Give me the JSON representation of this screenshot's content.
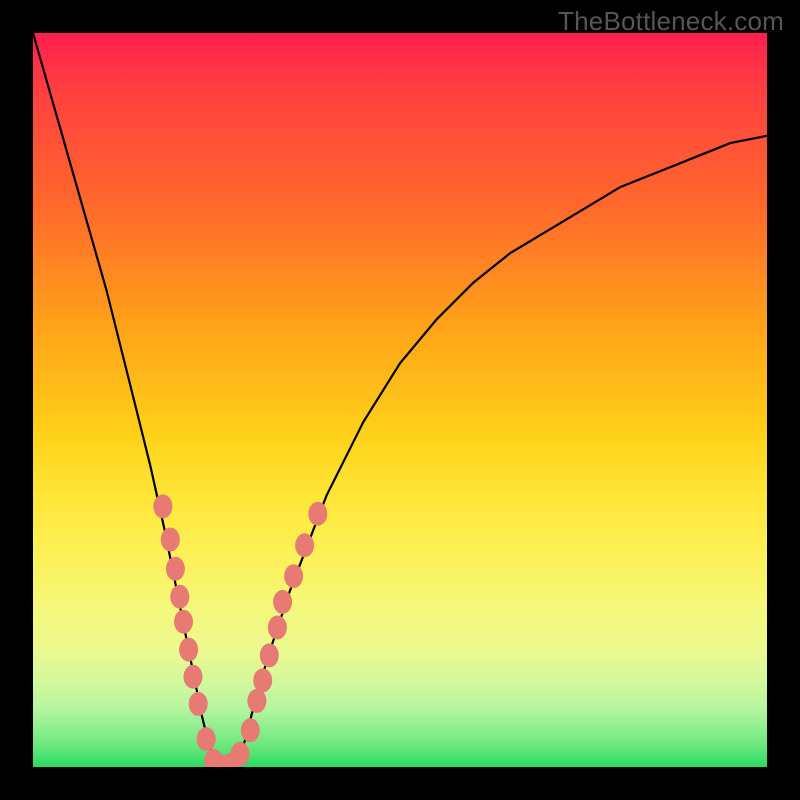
{
  "watermark": "TheBottleneck.com",
  "colors": {
    "frame": "#000000",
    "curve": "#000000",
    "marker_fill": "#e77b74",
    "marker_stroke": "#d2655e",
    "gradient_top": "#ff1f4e",
    "gradient_bottom": "#28db5f"
  },
  "chart_data": {
    "type": "line",
    "title": "",
    "xlabel": "",
    "ylabel": "",
    "xlim": [
      0,
      100
    ],
    "ylim": [
      0,
      100
    ],
    "grid": false,
    "annotations": [
      "TheBottleneck.com"
    ],
    "series": [
      {
        "name": "bottleneck-curve",
        "x": [
          0,
          2,
          4,
          6,
          8,
          10,
          12,
          14,
          16,
          18,
          20,
          21,
          22,
          23,
          24,
          25,
          26,
          27,
          28,
          29,
          30,
          32,
          35,
          40,
          45,
          50,
          55,
          60,
          65,
          70,
          75,
          80,
          85,
          90,
          95,
          100
        ],
        "y": [
          100,
          93,
          86,
          79,
          72,
          65,
          57,
          49,
          41,
          32,
          22,
          17,
          12,
          7,
          3,
          0,
          0,
          0,
          1,
          4,
          8,
          15,
          24,
          37,
          47,
          55,
          61,
          66,
          70,
          73,
          76,
          79,
          81,
          83,
          85,
          86
        ]
      }
    ],
    "markers": [
      {
        "x": 17.7,
        "y": 35.5
      },
      {
        "x": 18.7,
        "y": 31.0
      },
      {
        "x": 19.4,
        "y": 27.0
      },
      {
        "x": 20.0,
        "y": 23.2
      },
      {
        "x": 20.5,
        "y": 19.8
      },
      {
        "x": 21.2,
        "y": 16.0
      },
      {
        "x": 21.8,
        "y": 12.3
      },
      {
        "x": 22.5,
        "y": 8.6
      },
      {
        "x": 23.6,
        "y": 3.8
      },
      {
        "x": 24.6,
        "y": 0.8
      },
      {
        "x": 25.9,
        "y": 0.0
      },
      {
        "x": 27.0,
        "y": 0.3
      },
      {
        "x": 28.2,
        "y": 1.8
      },
      {
        "x": 29.6,
        "y": 5.0
      },
      {
        "x": 30.5,
        "y": 9.0
      },
      {
        "x": 31.3,
        "y": 11.8
      },
      {
        "x": 32.2,
        "y": 15.2
      },
      {
        "x": 33.3,
        "y": 19.0
      },
      {
        "x": 34.0,
        "y": 22.5
      },
      {
        "x": 35.5,
        "y": 26.0
      },
      {
        "x": 37.0,
        "y": 30.2
      },
      {
        "x": 38.8,
        "y": 34.5
      }
    ]
  }
}
